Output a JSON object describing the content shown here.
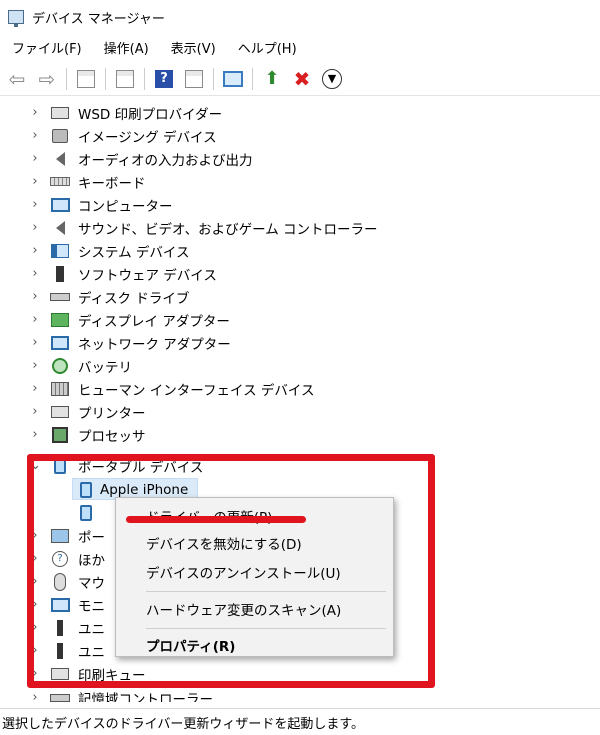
{
  "window": {
    "title": "デバイス マネージャー"
  },
  "menu": [
    "ファイル(F)",
    "操作(A)",
    "表示(V)",
    "ヘルプ(H)"
  ],
  "tree": {
    "rows": [
      {
        "label": "WSD 印刷プロバイダー",
        "icon": "printer-icon"
      },
      {
        "label": "イメージング デバイス",
        "icon": "camera-icon"
      },
      {
        "label": "オーディオの入力および出力",
        "icon": "speaker-icon"
      },
      {
        "label": "キーボード",
        "icon": "keyboard-icon"
      },
      {
        "label": "コンピューター",
        "icon": "monitor-icon"
      },
      {
        "label": "サウンド、ビデオ、およびゲーム コントローラー",
        "icon": "speaker-icon"
      },
      {
        "label": "システム デバイス",
        "icon": "system-icon"
      },
      {
        "label": "ソフトウェア デバイス",
        "icon": "software-icon"
      },
      {
        "label": "ディスク ドライブ",
        "icon": "drive-icon"
      },
      {
        "label": "ディスプレイ アダプター",
        "icon": "display-adapter-icon"
      },
      {
        "label": "ネットワーク アダプター",
        "icon": "network-icon"
      },
      {
        "label": "バッテリ",
        "icon": "battery-icon"
      },
      {
        "label": "ヒューマン インターフェイス デバイス",
        "icon": "hid-icon"
      },
      {
        "label": "プリンター",
        "icon": "printer-icon"
      },
      {
        "label": "プロセッサ",
        "icon": "cpu-icon"
      },
      {
        "label": "ポータブル デバイス",
        "icon": "phone-icon"
      },
      {
        "label": "Apple iPhone",
        "icon": "phone-icon"
      },
      {
        "label": "",
        "icon": "phone-icon"
      },
      {
        "label": "ポー",
        "icon": "port-icon"
      },
      {
        "label": "ほか",
        "icon": "other-icon"
      },
      {
        "label": "マウ",
        "icon": "mouse-icon"
      },
      {
        "label": "モニ",
        "icon": "monitor-icon"
      },
      {
        "label": "ユニ",
        "icon": "usb-icon"
      },
      {
        "label": "ユニ",
        "icon": "usb-icon"
      },
      {
        "label": "印刷キュー",
        "icon": "printer-icon"
      },
      {
        "label": "記憶域コントローラー",
        "icon": "drive-icon"
      }
    ]
  },
  "context_menu": {
    "update_driver": "ドライバーの更新(P)",
    "disable_device": "デバイスを無効にする(D)",
    "uninstall_device": "デバイスのアンインストール(U)",
    "scan_hardware": "ハードウェア変更のスキャン(A)",
    "properties": "プロパティ(R)"
  },
  "status_bar": {
    "text": "選択したデバイスのドライバー更新ウィザードを起動します。"
  },
  "colors": {
    "highlight": "#e0141e",
    "selection": "#dbeaf8"
  }
}
